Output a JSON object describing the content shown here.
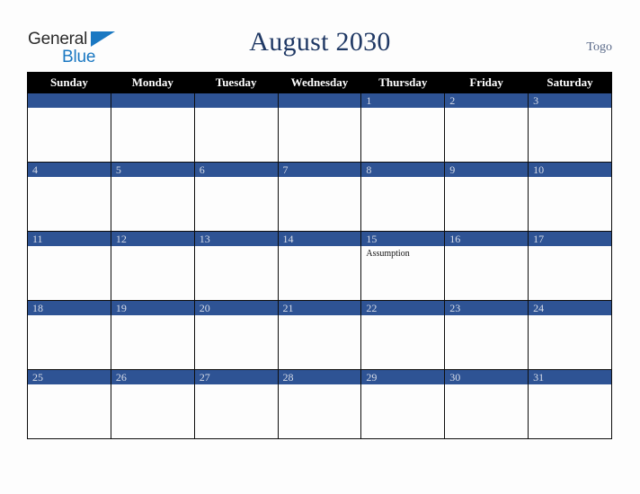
{
  "brand": {
    "word_one": "General",
    "word_two": "Blue",
    "triangle_icon": "triangle-icon",
    "color_dark": "#2b2b2b",
    "color_blue": "#1a78c2"
  },
  "header": {
    "title": "August 2030",
    "region": "Togo",
    "title_color": "#1f3864",
    "region_color": "#5a6a89"
  },
  "calendar": {
    "accent_color": "#2e5394",
    "header_bg": "#000000",
    "weekday_headers": [
      "Sunday",
      "Monday",
      "Tuesday",
      "Wednesday",
      "Thursday",
      "Friday",
      "Saturday"
    ],
    "weeks": [
      [
        {
          "day": "",
          "events": []
        },
        {
          "day": "",
          "events": []
        },
        {
          "day": "",
          "events": []
        },
        {
          "day": "",
          "events": []
        },
        {
          "day": "1",
          "events": []
        },
        {
          "day": "2",
          "events": []
        },
        {
          "day": "3",
          "events": []
        }
      ],
      [
        {
          "day": "4",
          "events": []
        },
        {
          "day": "5",
          "events": []
        },
        {
          "day": "6",
          "events": []
        },
        {
          "day": "7",
          "events": []
        },
        {
          "day": "8",
          "events": []
        },
        {
          "day": "9",
          "events": []
        },
        {
          "day": "10",
          "events": []
        }
      ],
      [
        {
          "day": "11",
          "events": []
        },
        {
          "day": "12",
          "events": []
        },
        {
          "day": "13",
          "events": []
        },
        {
          "day": "14",
          "events": []
        },
        {
          "day": "15",
          "events": [
            "Assumption"
          ]
        },
        {
          "day": "16",
          "events": []
        },
        {
          "day": "17",
          "events": []
        }
      ],
      [
        {
          "day": "18",
          "events": []
        },
        {
          "day": "19",
          "events": []
        },
        {
          "day": "20",
          "events": []
        },
        {
          "day": "21",
          "events": []
        },
        {
          "day": "22",
          "events": []
        },
        {
          "day": "23",
          "events": []
        },
        {
          "day": "24",
          "events": []
        }
      ],
      [
        {
          "day": "25",
          "events": []
        },
        {
          "day": "26",
          "events": []
        },
        {
          "day": "27",
          "events": []
        },
        {
          "day": "28",
          "events": []
        },
        {
          "day": "29",
          "events": []
        },
        {
          "day": "30",
          "events": []
        },
        {
          "day": "31",
          "events": []
        }
      ]
    ]
  }
}
